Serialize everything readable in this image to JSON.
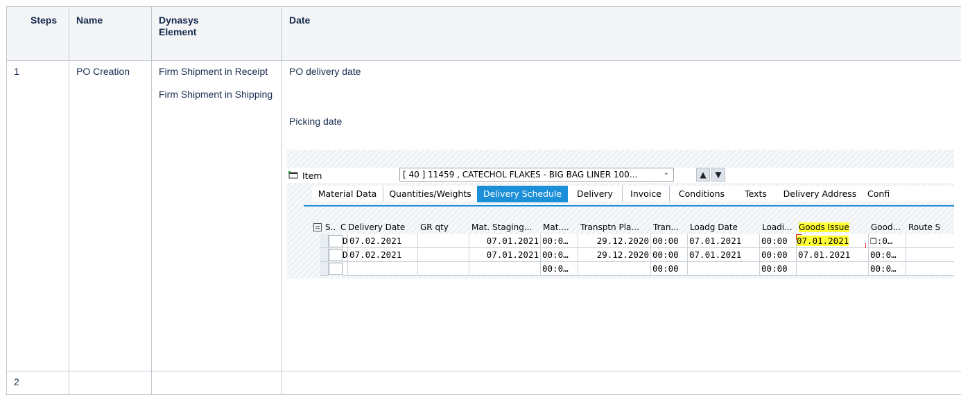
{
  "table": {
    "headers": {
      "steps": "Steps",
      "name": "Name",
      "element_line1": "Dynasys",
      "element_line2": "Element",
      "date": "Date"
    },
    "rows": [
      {
        "step": "1",
        "name": "PO Creation",
        "elements": [
          "Firm Shipment in Receipt",
          "Firm Shipment in Shipping"
        ],
        "dates": [
          "PO delivery date",
          "Picking date"
        ]
      },
      {
        "step": "2",
        "name": "",
        "elements": [],
        "dates": []
      }
    ]
  },
  "sap": {
    "item_label": "Item",
    "item_value": "[ 40 ] 11459 , CATECHOL FLAKES - BIG BAG LINER 100…",
    "nav_up": "▲",
    "nav_down": "▼",
    "tabs": [
      {
        "label": "Material Data",
        "active": false
      },
      {
        "label": "Quantities/Weights",
        "active": false
      },
      {
        "label": "Delivery Schedule",
        "active": true
      },
      {
        "label": "Delivery",
        "active": false
      },
      {
        "label": "Invoice",
        "active": false
      },
      {
        "label": "Conditions",
        "active": false
      },
      {
        "label": "Texts",
        "active": false
      },
      {
        "label": "Delivery Address",
        "active": false
      },
      {
        "label": "Confi",
        "active": false
      }
    ],
    "columns": [
      "S..",
      "C",
      "Delivery Date",
      "GR qty",
      "Mat. Staging...",
      "Mat....",
      "Transptn Pla...",
      "Tran...",
      "Loadg Date",
      "Loadi...",
      "Goods Issue",
      "Good...",
      "Route S"
    ],
    "highlighted_column": "Goods Issue",
    "rows": [
      {
        "c": "D",
        "delivery_date": "07.02.2021",
        "gr_qty": "",
        "mat_staging": "07.01.2021",
        "mat_time": "00:0…",
        "transptn": "29.12.2020",
        "tran_time": "00:00",
        "loadg_date": "07.01.2021",
        "loadi_time": "00:00",
        "goods_issue": "07.01.2021",
        "good_time": ":0…"
      },
      {
        "c": "D",
        "delivery_date": "07.02.2021",
        "gr_qty": "",
        "mat_staging": "07.01.2021",
        "mat_time": "00:0…",
        "transptn": "29.12.2020",
        "tran_time": "00:00",
        "loadg_date": "07.01.2021",
        "loadi_time": "00:00",
        "goods_issue": "07.01.2021",
        "good_time": "00:0…"
      },
      {
        "c": "",
        "delivery_date": "",
        "gr_qty": "",
        "mat_staging": "",
        "mat_time": "00:0…",
        "transptn": "",
        "tran_time": "00:00",
        "loadg_date": "",
        "loadi_time": "00:00",
        "goods_issue": "",
        "good_time": "00:0…"
      }
    ],
    "colors": {
      "active_tab": "#1b8fd8",
      "highlight": "#ffff33",
      "cursor_mark": "#e02020"
    }
  }
}
